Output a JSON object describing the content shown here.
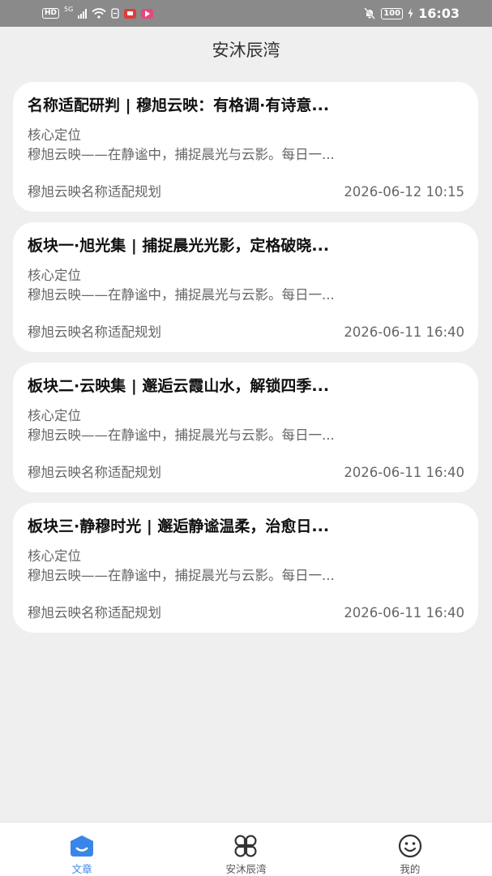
{
  "status_bar": {
    "hd_badge": "HD",
    "network": "5G",
    "battery": "100",
    "time": "16:03"
  },
  "header": {
    "title": "安沐辰湾"
  },
  "articles": [
    {
      "title": "名称适配研判 | 穆旭云映：有格调·有诗意...",
      "subtitle": "核心定位",
      "excerpt": "穆旭云映——在静谧中，捕捉晨光与云影。每日一...",
      "category": "穆旭云映名称适配规划",
      "date": "2026-06-12 10:15"
    },
    {
      "title": "板块一·旭光集 | 捕捉晨光光影，定格破晓...",
      "subtitle": "核心定位",
      "excerpt": "穆旭云映——在静谧中，捕捉晨光与云影。每日一...",
      "category": "穆旭云映名称适配规划",
      "date": "2026-06-11 16:40"
    },
    {
      "title": "板块二·云映集 | 邂逅云霞山水，解锁四季...",
      "subtitle": "核心定位",
      "excerpt": "穆旭云映——在静谧中，捕捉晨光与云影。每日一...",
      "category": "穆旭云映名称适配规划",
      "date": "2026-06-11 16:40"
    },
    {
      "title": "板块三·静穆时光 | 邂逅静谧温柔，治愈日...",
      "subtitle": "核心定位",
      "excerpt": "穆旭云映——在静谧中，捕捉晨光与云影。每日一...",
      "category": "穆旭云映名称适配规划",
      "date": "2026-06-11 16:40"
    }
  ],
  "bottom_nav": {
    "items": [
      {
        "label": "文章",
        "icon": "article-home-icon",
        "active": true
      },
      {
        "label": "安沐辰湾",
        "icon": "four-leaf-grid-icon",
        "active": false
      },
      {
        "label": "我的",
        "icon": "smiley-face-icon",
        "active": false
      }
    ]
  },
  "colors": {
    "accent": "#3a86e8",
    "background": "#efefef",
    "status_bar": "#8a8a8a"
  }
}
